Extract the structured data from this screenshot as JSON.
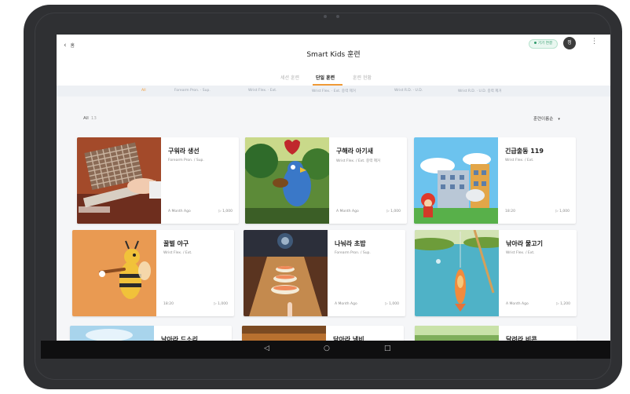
{
  "app": {
    "back_label": "홈",
    "title": "Smart Kids 훈련",
    "status_pill": "기기 연결",
    "avatar_initial": "정",
    "more_glyph": "⋮",
    "back_glyph": "‹"
  },
  "tabs": [
    {
      "label": "세션 훈련",
      "active": false
    },
    {
      "label": "단일 훈련",
      "active": true
    },
    {
      "label": "훈련 현황",
      "active": false
    }
  ],
  "filters": [
    {
      "label": "All",
      "active": true
    },
    {
      "label": "Forearm Pron. · Sup.",
      "active": false
    },
    {
      "label": "Wrist Flex. · Ext.",
      "active": false
    },
    {
      "label": "Wrist Flex. · Ext. 중력 제거",
      "active": false
    },
    {
      "label": "Wrist R.D. · U.D.",
      "active": false
    },
    {
      "label": "Wrist R.D. · U.D. 중력 제거",
      "active": false
    }
  ],
  "list": {
    "all_label": "All",
    "count": "13",
    "sort_label": "훈련이름순",
    "sort_caret": "▾"
  },
  "cards": [
    {
      "title": "구워라 생선",
      "sub": "Forearm Pron. / Sup.",
      "date": "A Month Ago",
      "plays": "▷ 1,000",
      "thumb": "grill-fish"
    },
    {
      "title": "구해라 아기새",
      "sub": "Wrist Flex. / Ext. 중력 제거",
      "date": "A Month Ago",
      "plays": "▷ 1,000",
      "thumb": "parrot"
    },
    {
      "title": "긴급출동 119",
      "sub": "Wrist Flex. / Ext.",
      "date": "18:20",
      "plays": "▷ 1,000",
      "thumb": "firefighter"
    },
    {
      "title": "꿀벌 야구",
      "sub": "Wrist Flex. / Ext.",
      "date": "18:20",
      "plays": "▷ 1,000",
      "thumb": "bee-baseball"
    },
    {
      "title": "나눠라 초밥",
      "sub": "Forearm Pron. / Sup.",
      "date": "A Month Ago",
      "plays": "▷ 1,000",
      "thumb": "sushi"
    },
    {
      "title": "낚아라 물고기",
      "sub": "Wrist Flex. / Ext.",
      "date": "A Month Ago",
      "plays": "▷ 1,200",
      "thumb": "fishing"
    },
    {
      "title": "날아라 드소리",
      "sub": "",
      "date": "",
      "plays": "",
      "thumb": "sky"
    },
    {
      "title": "닦아라 냄비",
      "sub": "",
      "date": "",
      "plays": "",
      "thumb": "kitchen"
    },
    {
      "title": "달려라 비콘",
      "sub": "",
      "date": "",
      "plays": "",
      "thumb": "field"
    }
  ],
  "navbar": {
    "back_glyph": "◁",
    "home_glyph": "○",
    "recents_glyph": "□"
  },
  "colors": {
    "accent": "#f09a36",
    "device": "#2f3033",
    "background": "#f5f6f8"
  }
}
